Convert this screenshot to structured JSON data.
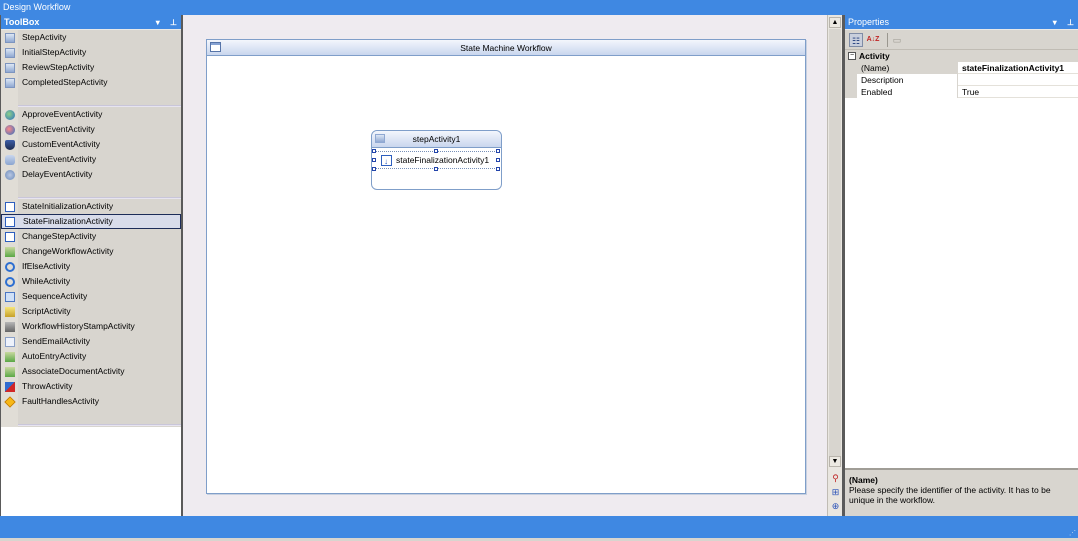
{
  "window": {
    "title": "Design Workflow"
  },
  "toolbox": {
    "title": "ToolBox",
    "dropdown_icon": "▾",
    "pin_icon": "⊥",
    "groups": [
      {
        "items": [
          {
            "label": "StepActivity",
            "icon": "step-icon"
          },
          {
            "label": "InitialStepActivity",
            "icon": "initial-step-icon"
          },
          {
            "label": "ReviewStepActivity",
            "icon": "review-step-icon"
          },
          {
            "label": "CompletedStepActivity",
            "icon": "completed-step-icon"
          }
        ]
      },
      {
        "items": [
          {
            "label": "ApproveEventActivity",
            "icon": "approve-event-icon"
          },
          {
            "label": "RejectEventActivity",
            "icon": "reject-event-icon"
          },
          {
            "label": "CustomEventActivity",
            "icon": "custom-event-icon"
          },
          {
            "label": "CreateEventActivity",
            "icon": "create-event-icon"
          },
          {
            "label": "DelayEventActivity",
            "icon": "delay-event-icon"
          }
        ]
      },
      {
        "items": [
          {
            "label": "StateInitializationActivity",
            "icon": "state-initialization-icon"
          },
          {
            "label": "StateFinalizationActivity",
            "icon": "state-finalization-icon",
            "selected": true
          },
          {
            "label": "ChangeStepActivity",
            "icon": "change-step-icon"
          },
          {
            "label": "ChangeWorkflowActivity",
            "icon": "change-workflow-icon"
          },
          {
            "label": "IfElseActivity",
            "icon": "if-else-icon"
          },
          {
            "label": "WhileActivity",
            "icon": "while-icon"
          },
          {
            "label": "SequenceActivity",
            "icon": "sequence-icon"
          },
          {
            "label": "ScriptActivity",
            "icon": "script-icon"
          },
          {
            "label": "WorkflowHistoryStampActivity",
            "icon": "history-stamp-icon"
          },
          {
            "label": "SendEmailActivity",
            "icon": "send-email-icon"
          },
          {
            "label": "AutoEntryActivity",
            "icon": "auto-entry-icon"
          },
          {
            "label": "AssociateDocumentActivity",
            "icon": "associate-document-icon"
          },
          {
            "label": "ThrowActivity",
            "icon": "throw-icon"
          },
          {
            "label": "FaultHandlesActivity",
            "icon": "fault-handles-icon"
          }
        ]
      }
    ]
  },
  "designer": {
    "workflow_title": "State Machine Workflow",
    "state": {
      "title": "stepActivity1",
      "child": "stateFinalizationActivity1"
    },
    "scroll_up": "▲",
    "scroll_down": "▼",
    "nav_icons": [
      "zoom-icon",
      "find-icon",
      "pan-icon"
    ]
  },
  "properties": {
    "title": "Properties",
    "toolbar": {
      "categorized": "categorized-icon",
      "alphabetical": "A↓Z",
      "property_pages": "property-pages-icon"
    },
    "category": "Activity",
    "expander": "−",
    "rows": [
      {
        "name": "(Name)",
        "value": "stateFinalizationActivity1",
        "selected": true
      },
      {
        "name": "Description",
        "value": ""
      },
      {
        "name": "Enabled",
        "value": "True"
      }
    ],
    "description": {
      "title": "(Name)",
      "text": "Please specify the identifier of the activity. It has to be unique in the workflow."
    }
  },
  "statusbar": {
    "grip": "⋰"
  }
}
